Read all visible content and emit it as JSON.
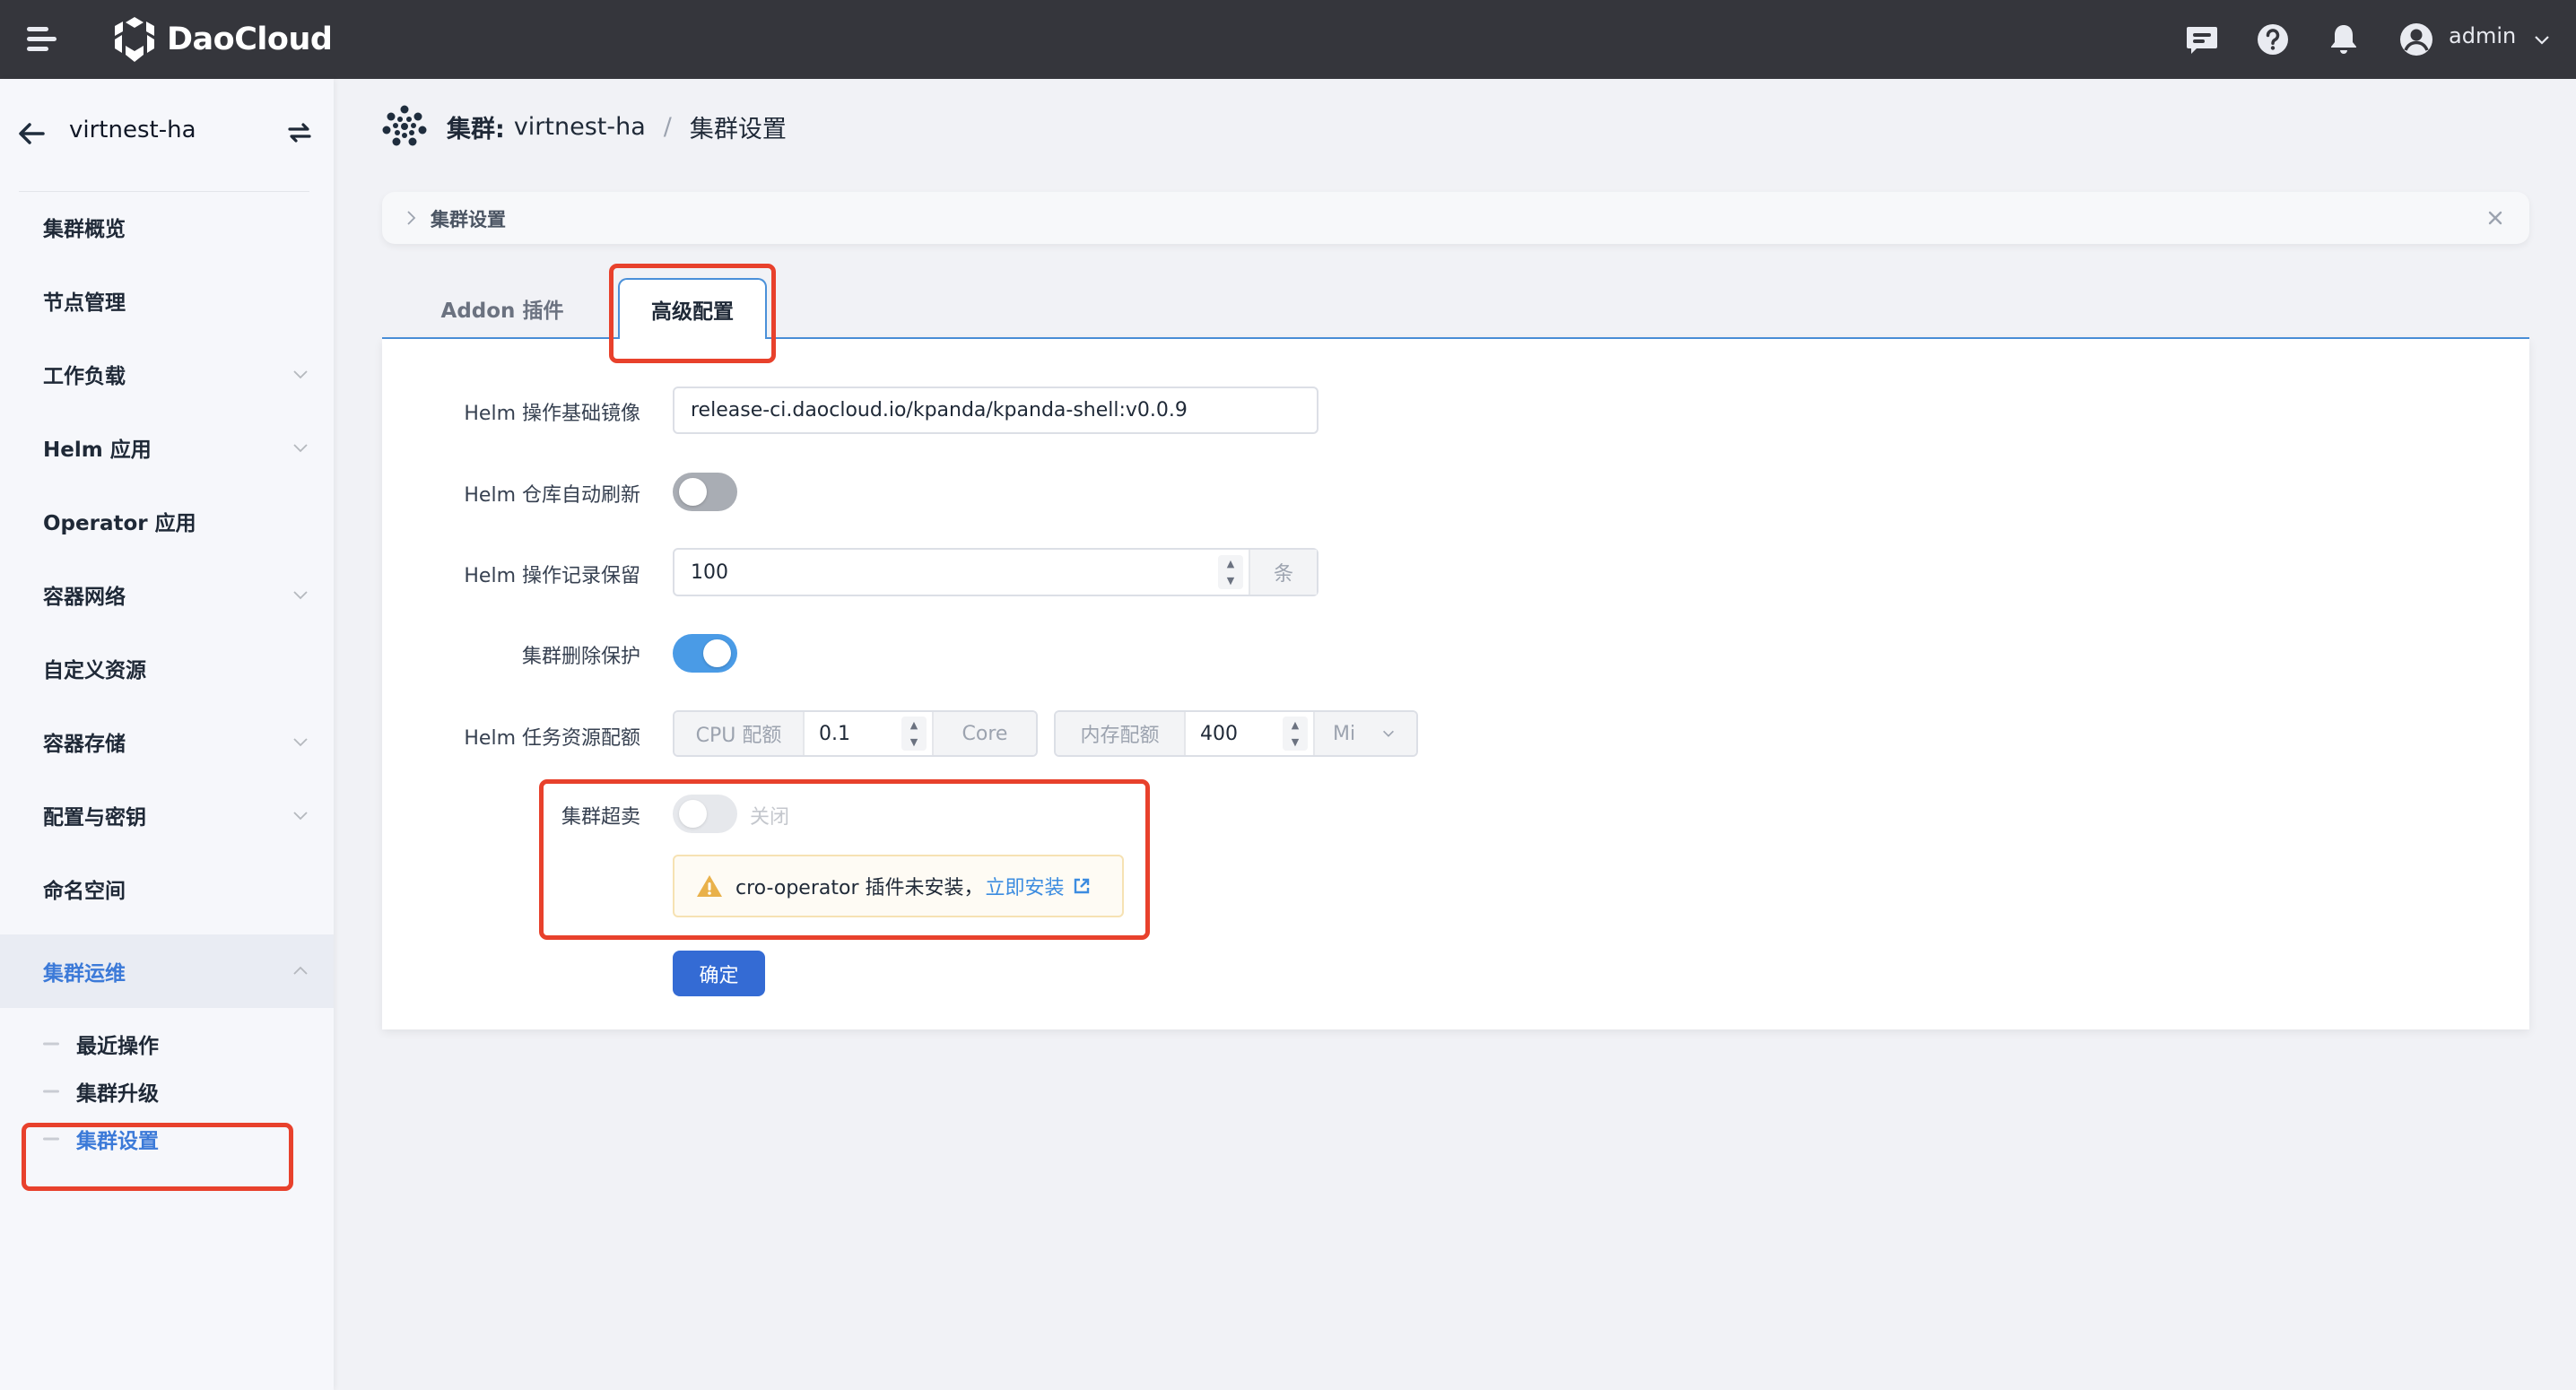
{
  "header": {
    "brand": "DaoCloud",
    "user": "admin",
    "icons": [
      "menu-icon",
      "message-icon",
      "help-icon",
      "bell-icon",
      "user-avatar-icon",
      "chevron-down-icon"
    ]
  },
  "sidebar": {
    "cluster_name": "virtnest-ha",
    "items": [
      {
        "label": "集群概览",
        "expandable": false
      },
      {
        "label": "节点管理",
        "expandable": false
      },
      {
        "label": "工作负载",
        "expandable": true
      },
      {
        "label": "Helm 应用",
        "expandable": true
      },
      {
        "label": "Operator 应用",
        "expandable": false
      },
      {
        "label": "容器网络",
        "expandable": true
      },
      {
        "label": "自定义资源",
        "expandable": false
      },
      {
        "label": "容器存储",
        "expandable": true
      },
      {
        "label": "配置与密钥",
        "expandable": true
      },
      {
        "label": "命名空间",
        "expandable": false
      },
      {
        "label": "集群运维",
        "expandable": true,
        "expanded": true,
        "active": true
      }
    ],
    "sub_items": [
      {
        "label": "最近操作"
      },
      {
        "label": "集群升级"
      },
      {
        "label": "集群设置",
        "active": true
      }
    ]
  },
  "breadcrumb": {
    "key": "集群:",
    "cluster": "virtnest-ha",
    "separator": "/",
    "current": "集群设置"
  },
  "collapse": {
    "title": "集群设置"
  },
  "tabs": [
    {
      "label": "Addon 插件",
      "active": false
    },
    {
      "label": "高级配置",
      "active": true
    }
  ],
  "form": {
    "base_image": {
      "label": "Helm 操作基础镜像",
      "value": "release-ci.daocloud.io/kpanda/kpanda-shell:v0.0.9"
    },
    "auto_refresh": {
      "label": "Helm 仓库自动刷新",
      "enabled": false
    },
    "history": {
      "label": "Helm 操作记录保留",
      "value": "100",
      "unit": "条"
    },
    "delete_protection": {
      "label": "集群删除保护",
      "enabled": true
    },
    "resources": {
      "label": "Helm 任务资源配额",
      "cpu_label": "CPU 配额",
      "cpu_value": "0.1",
      "cpu_unit": "Core",
      "mem_label": "内存配额",
      "mem_value": "400",
      "mem_unit": "Mi"
    },
    "overcommit": {
      "label": "集群超卖",
      "enabled": false,
      "disabled": true,
      "status": "关闭",
      "warning_text": "cro-operator 插件未安装，",
      "warning_link": "立即安装"
    },
    "submit_label": "确定"
  },
  "colors": {
    "header_bg": "#35363c",
    "accent": "#346bd4",
    "active_text": "#3c7ad8",
    "toggle_on": "#4a9be6",
    "annotation": "#e8412c",
    "warning": "#e9b14a"
  }
}
